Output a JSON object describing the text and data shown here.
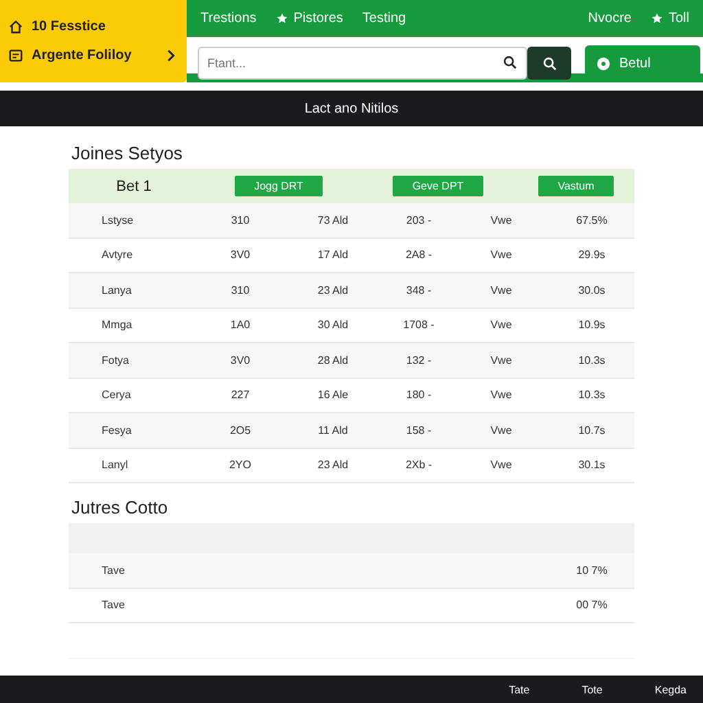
{
  "promo_panel": {
    "items": [
      {
        "kind": "home",
        "label": "10 Fesstice"
      },
      {
        "kind": "card",
        "label": "Argente  Foliloy"
      }
    ]
  },
  "nav": {
    "links": [
      {
        "label": "Trestions",
        "icon": false
      },
      {
        "label": "Pistores",
        "icon": true
      },
      {
        "label": "Testing",
        "icon": false
      }
    ],
    "right_links": [
      {
        "label": "Nvocre",
        "icon": false
      },
      {
        "label": "Toll",
        "icon": true
      }
    ]
  },
  "search": {
    "placeholder": "Ftant..."
  },
  "action_button": {
    "label": "Betul"
  },
  "banner": {
    "title": "Lact ano Nitilos"
  },
  "main_table": {
    "title": "Joines Setyos",
    "header_label": "Bet 1",
    "header_buttons": [
      "Jogg DRT",
      "Geve DPT",
      "Vastum"
    ],
    "rows": [
      [
        "Lstyse",
        "310",
        "73 Ald",
        "203 -",
        "Vwe",
        "67.5%"
      ],
      [
        "Avtyre",
        "3V0",
        "17 Ald",
        "2A8 -",
        "Vwe",
        "29.9s"
      ],
      [
        "Lanya",
        "310",
        "23 Ald",
        "348 -",
        "Vwe",
        "30.0s"
      ],
      [
        "Mmga",
        "1A0",
        "30 Ald",
        "1708 -",
        "Vwe",
        "10.9s"
      ],
      [
        "Fotya",
        "3V0",
        "28 Ald",
        "132 -",
        "Vwe",
        "10.3s"
      ],
      [
        "Cerya",
        "227",
        "16 Ale",
        "180 -",
        "Vwe",
        "10.3s"
      ],
      [
        "Fesya",
        "2O5",
        "11 Ald",
        "158 -",
        "Vwe",
        "10.7s"
      ],
      [
        "Lanyl",
        "2YO",
        "23 Ald",
        "2Xb -",
        "Vwe",
        "30.1s"
      ]
    ]
  },
  "second_table": {
    "title": "Jutres Cotto",
    "rows": [
      {
        "column_1": "Tave",
        "column_6": "10 7%"
      },
      {
        "column_1": "Tave",
        "column_6": "00 7%"
      }
    ]
  },
  "footer": {
    "links": [
      "Tate",
      "Tote",
      "Kegda"
    ]
  }
}
